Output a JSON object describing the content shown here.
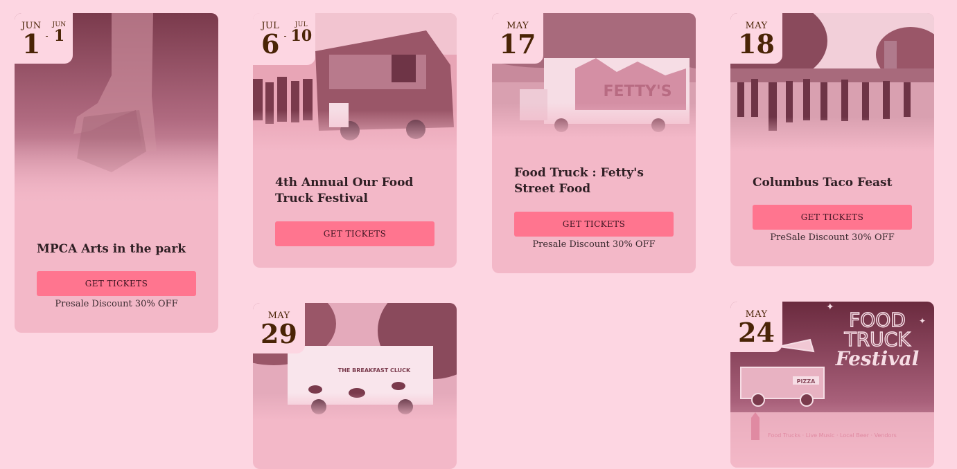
{
  "events": [
    {
      "id": "mpca",
      "date": {
        "start_month": "JUN",
        "start_day": "1",
        "end_month": "JUN",
        "end_day": "1"
      },
      "title": "MPCA Arts in the park",
      "button": "GET TICKETS",
      "promo": "Presale Discount 30% OFF"
    },
    {
      "id": "our-food-truck",
      "date": {
        "start_month": "JUL",
        "start_day": "6",
        "end_month": "JUL",
        "end_day": "10"
      },
      "title": "4th Annual Our Food Truck Festival",
      "button": "GET TICKETS"
    },
    {
      "id": "fetty",
      "date": {
        "month": "MAY",
        "day": "17"
      },
      "title": "Food Truck : Fetty's Street Food",
      "button": "GET TICKETS",
      "promo": "Presale Discount 30% OFF",
      "truck_text": "FETTY'S"
    },
    {
      "id": "taco",
      "date": {
        "month": "MAY",
        "day": "18"
      },
      "title": "Columbus Taco Feast",
      "button": "GET TICKETS",
      "promo": "PreSale Discount 30% OFF"
    },
    {
      "id": "breakfast",
      "date": {
        "month": "MAY",
        "day": "29"
      },
      "truck_text": "THE BREAKFAST CLUCK"
    },
    {
      "id": "festival-poster",
      "date": {
        "month": "MAY",
        "day": "24"
      },
      "poster": {
        "line1": "FOOD",
        "line2": "TRUCK",
        "line3": "Festival",
        "sign": "PIZZA",
        "footer": "Food Trucks · Live Music · Local Beer · Vendors"
      }
    }
  ]
}
